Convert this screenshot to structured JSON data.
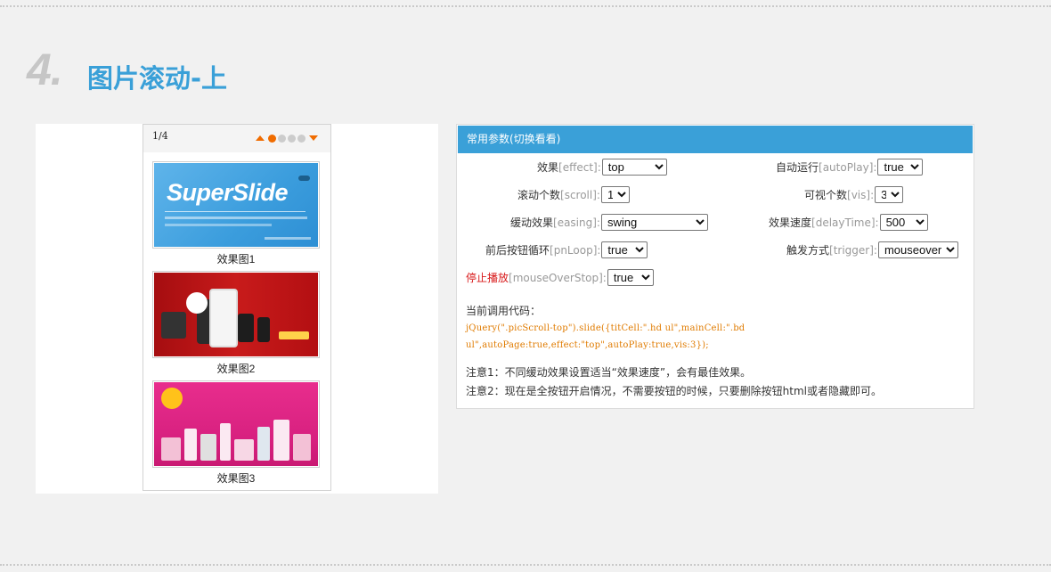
{
  "section": {
    "number": "4.",
    "title": "图片滚动-上"
  },
  "demo": {
    "page_indicator": "1/4",
    "dots": [
      true,
      false,
      false,
      false
    ],
    "items": [
      {
        "caption": "效果图1",
        "image_text": "SuperSlide"
      },
      {
        "caption": "效果图2"
      },
      {
        "caption": "效果图3"
      }
    ]
  },
  "params": {
    "header": "常用参数(切换看看)",
    "fields": {
      "effect": {
        "label": "效果",
        "en": "[effect]:",
        "value": "top"
      },
      "autoPlay": {
        "label": "自动运行",
        "en": "[autoPlay]:",
        "value": "true"
      },
      "scroll": {
        "label": "滚动个数",
        "en": "[scroll]:",
        "value": "1"
      },
      "vis": {
        "label": "可视个数",
        "en": "[vis]:",
        "value": "3"
      },
      "easing": {
        "label": "缓动效果",
        "en": "[easing]:",
        "value": "swing"
      },
      "delayTime": {
        "label": "效果速度",
        "en": "[delayTime]:",
        "value": "500"
      },
      "pnLoop": {
        "label": "前后按钮循环",
        "en": "[pnLoop]:",
        "value": "true"
      },
      "trigger": {
        "label": "触发方式",
        "en": "[trigger]:",
        "value": "mouseover"
      },
      "mouseOverStop": {
        "label": "停止播放",
        "en": "[mouseOverStop]:",
        "value": "true"
      }
    },
    "code_label": "当前调用代码：",
    "code_line1": "jQuery(\".picScroll-top\").slide({titCell:\".hd ul\",mainCell:\".bd",
    "code_line2": "ul\",autoPage:true,effect:\"top\",autoPlay:true,vis:3});",
    "note1": "注意1：不同缓动效果设置适当“效果速度”，会有最佳效果。",
    "note2": "注意2：现在是全按钮开启情况，不需要按钮的时候，只要删除按钮html或者隐藏即可。"
  }
}
